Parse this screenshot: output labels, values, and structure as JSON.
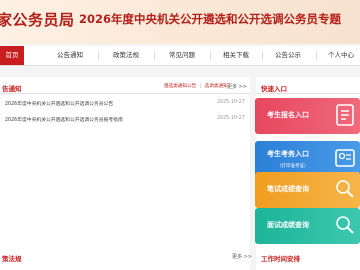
{
  "header": {
    "logo": "家公务员局",
    "title": "2026年度中央机关公开遴选和公开选调公务员专题"
  },
  "nav": {
    "items": [
      "首页",
      "公告通知",
      "政策法规",
      "常见问题",
      "相关下载",
      "公告公示",
      "个人中心"
    ]
  },
  "notices": {
    "title": "告通知",
    "link1": "遴选类通知公告",
    "separator": "|",
    "link2": "选调类通知",
    "more": "更多 >>",
    "items": [
      {
        "text": "2026年度中央机关公开遴选和公开选调公务员公告",
        "date": "2025-10-27"
      },
      {
        "text": "2026年度中央机关公开遴选和公开选调公务员报考指南",
        "date": "2025-10-27"
      }
    ]
  },
  "policy": {
    "title": "策法规",
    "more": "更多 >>"
  },
  "quick": {
    "title": "快速入口",
    "items": [
      {
        "label": "考生报名入口",
        "sub": "",
        "color": "#e0445e"
      },
      {
        "label": "考生考务入口",
        "sub": "（打印准考证）",
        "color": "#2a7fd4"
      },
      {
        "label": "笔试成绩查询",
        "sub": "",
        "color": "#f0a020"
      },
      {
        "label": "面试成绩查询",
        "sub": "",
        "color": "#1fb59a"
      }
    ]
  },
  "schedule": {
    "title": "工作时间安排"
  },
  "colors": {
    "brand": "#c81e1e"
  }
}
